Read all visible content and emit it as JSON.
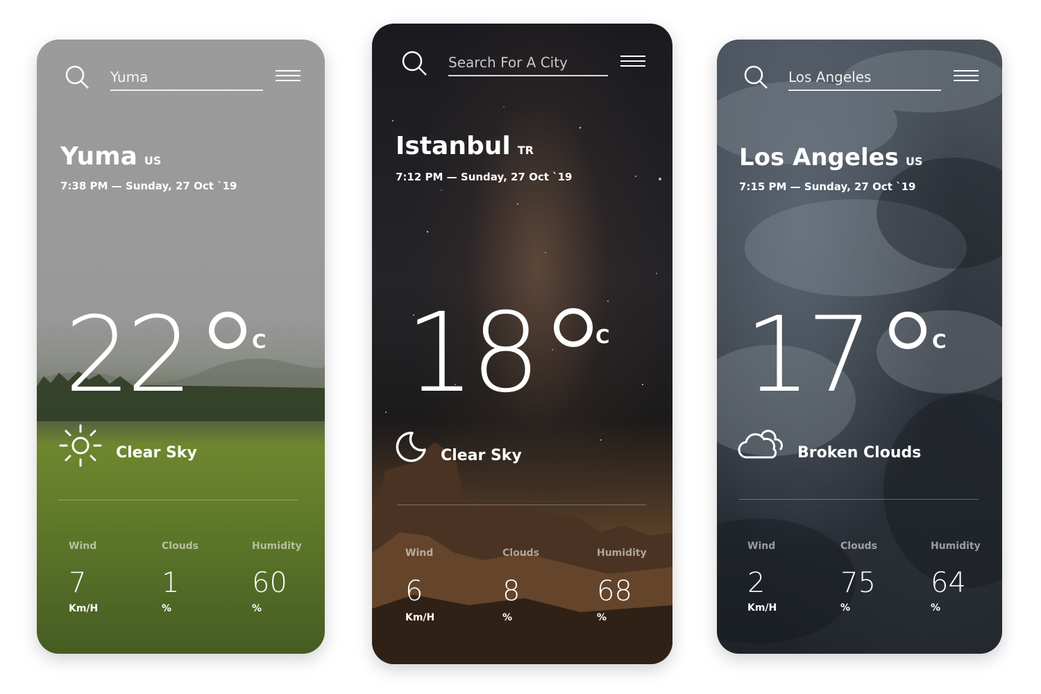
{
  "cards": [
    {
      "search": {
        "value": "Yuma",
        "placeholder": ""
      },
      "city": "Yuma",
      "country": "US",
      "datetime": "7:38 PM — Sunday, 27 Oct `19",
      "temperature": "22",
      "unit": "C",
      "condition": "Clear Sky",
      "condition_icon": "sun-icon",
      "wind": {
        "label": "Wind",
        "value": "7",
        "unit": "Km/H"
      },
      "clouds": {
        "label": "Clouds",
        "value": "1",
        "unit": "%"
      },
      "humidity": {
        "label": "Humidity",
        "value": "60",
        "unit": "%"
      }
    },
    {
      "search": {
        "value": "",
        "placeholder": "Search For A City"
      },
      "city": "Istanbul",
      "country": "TR",
      "datetime": "7:12 PM — Sunday, 27 Oct `19",
      "temperature": "18",
      "unit": "C",
      "condition": "Clear Sky",
      "condition_icon": "moon-icon",
      "wind": {
        "label": "Wind",
        "value": "6",
        "unit": "Km/H"
      },
      "clouds": {
        "label": "Clouds",
        "value": "8",
        "unit": "%"
      },
      "humidity": {
        "label": "Humidity",
        "value": "68",
        "unit": "%"
      }
    },
    {
      "search": {
        "value": "Los Angeles",
        "placeholder": ""
      },
      "city": "Los Angeles",
      "country": "US",
      "datetime": "7:15 PM — Sunday, 27 Oct `19",
      "temperature": "17",
      "unit": "C",
      "condition": "Broken Clouds",
      "condition_icon": "cloud-icon",
      "wind": {
        "label": "Wind",
        "value": "2",
        "unit": "Km/H"
      },
      "clouds": {
        "label": "Clouds",
        "value": "75",
        "unit": "%"
      },
      "humidity": {
        "label": "Humidity",
        "value": "64",
        "unit": "%"
      }
    }
  ]
}
